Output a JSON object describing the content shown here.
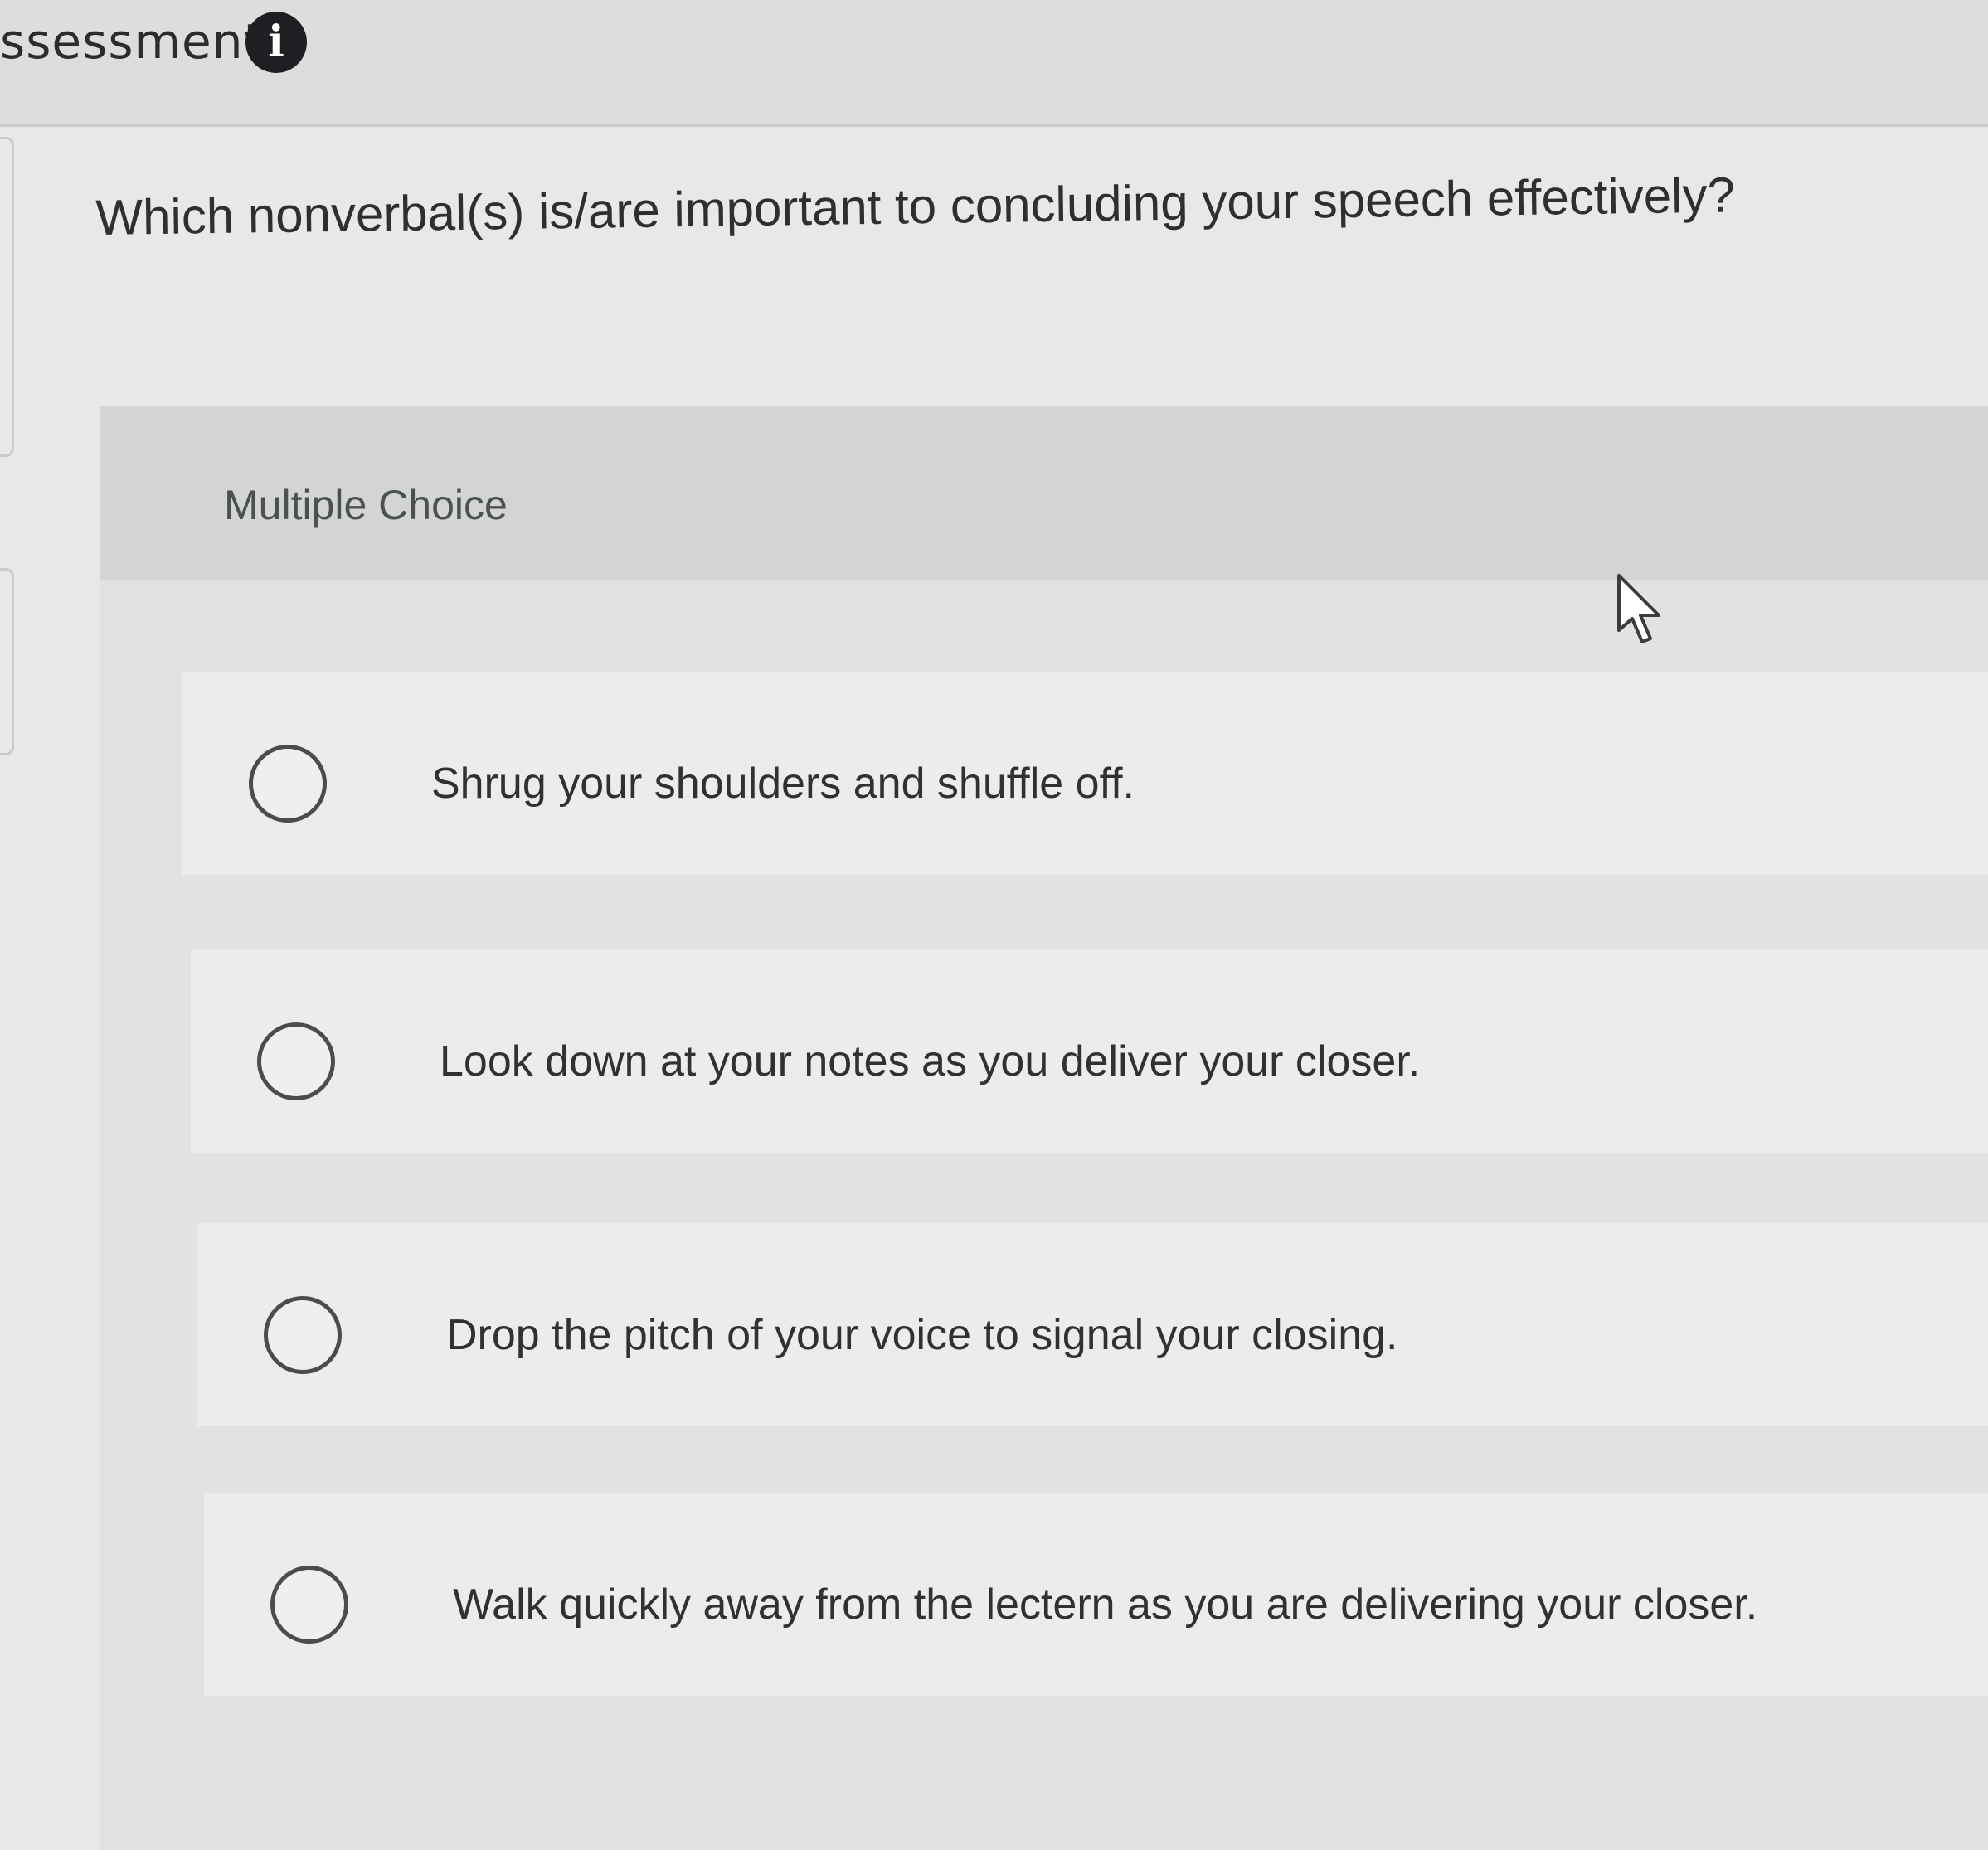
{
  "header": {
    "title": "ssessment",
    "info_icon": "info-icon",
    "info_glyph": "i"
  },
  "question": {
    "text": "Which nonverbal(s) is/are important to concluding your speech effectively?"
  },
  "answer_panel": {
    "type_label": "Multiple Choice",
    "options": [
      {
        "label": "Shrug your shoulders and shuffle off.",
        "selected": false
      },
      {
        "label": "Look down at your notes as you deliver your closer.",
        "selected": false
      },
      {
        "label": "Drop the pitch of your voice to signal your closing.",
        "selected": false
      },
      {
        "label": "Walk quickly away from the lectern as you are delivering your closer.",
        "selected": false
      }
    ]
  },
  "pointer": {
    "icon": "mouse-pointer-icon"
  }
}
